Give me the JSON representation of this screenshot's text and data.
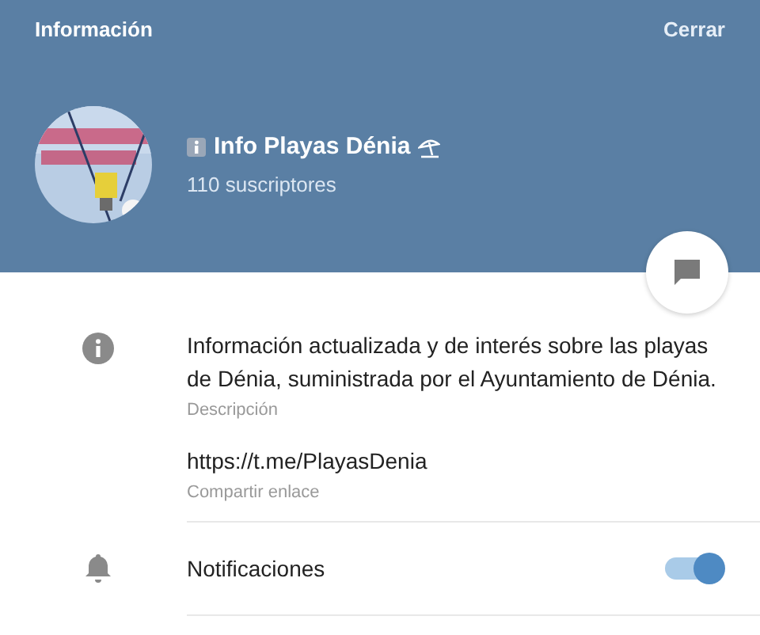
{
  "header": {
    "title": "Información",
    "close": "Cerrar"
  },
  "channel": {
    "name": "Info Playas Dénia",
    "subscribers": "110 suscriptores"
  },
  "info": {
    "description": "Información actualizada y de interés sobre las playas de Dénia, suministrada por el Ayuntamiento de Dénia.",
    "description_label": "Descripción",
    "link": "https://t.me/PlayasDenia",
    "link_label": "Compartir enlace"
  },
  "notifications": {
    "label": "Notificaciones",
    "on": true
  }
}
